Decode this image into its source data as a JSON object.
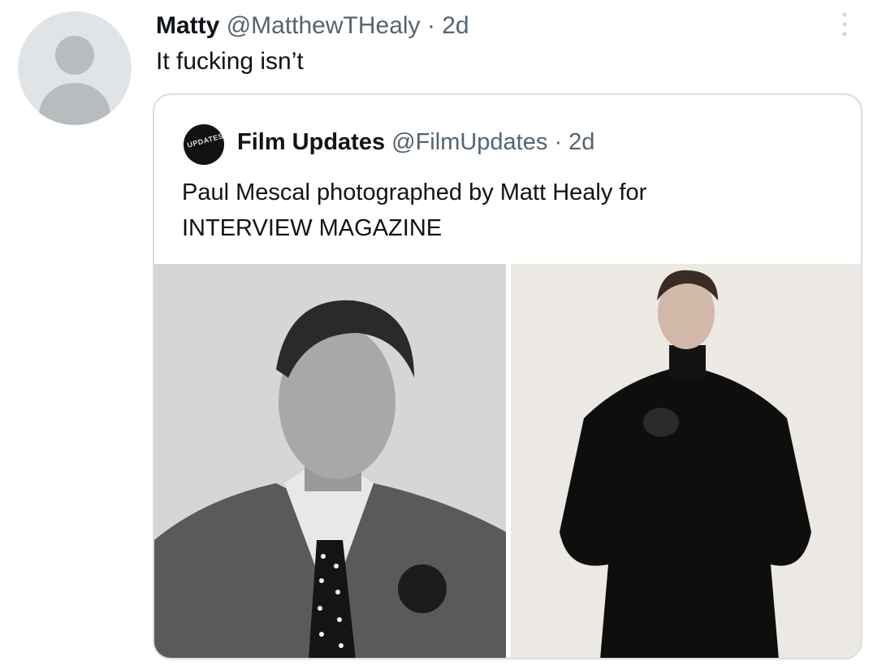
{
  "tweet": {
    "author_name": "Matty",
    "author_handle": "@MatthewTHealy",
    "separator": "·",
    "time": "2d",
    "text": "It fucking isn’t",
    "avatar_icon": "default-profile-icon",
    "more_icon": "more-options-icon"
  },
  "quoted_tweet": {
    "author_name": "Film Updates",
    "author_handle": "@FilmUpdates",
    "separator": "·",
    "time": "2d",
    "avatar_logo_text": "UPDATES",
    "text_line1": "Paul Mescal photographed by Matt Healy for",
    "text_line2": "INTERVIEW MAGAZINE",
    "photos": [
      {
        "description_icon": "bw-portrait-photo"
      },
      {
        "description_icon": "black-coat-portrait-photo"
      }
    ]
  }
}
